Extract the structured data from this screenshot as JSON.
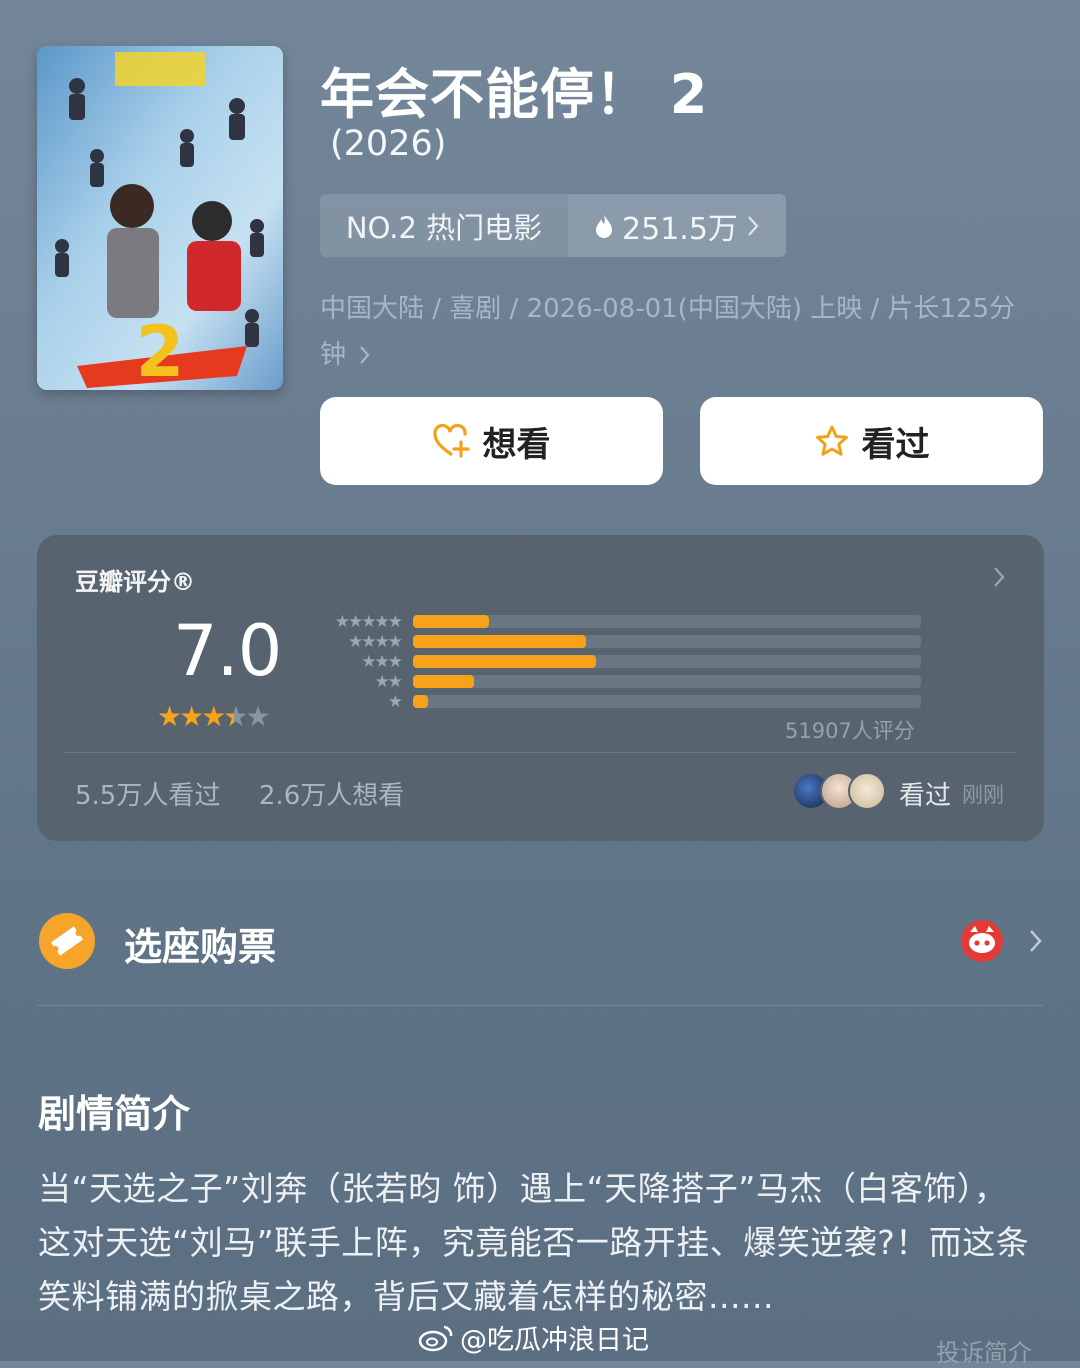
{
  "movie": {
    "title": "年会不能停！ 2",
    "year": "(2026)",
    "rank": "NO.2 热门电影",
    "heat": "251.5万",
    "meta_line": "中国大陆 / 喜剧 / 2026-08-01(中国大陆) 上映 / 片长125分钟"
  },
  "actions": {
    "want_label": "想看",
    "seen_label": "看过"
  },
  "rating": {
    "title": "豆瓣评分®",
    "score": "7.0",
    "stars_value": 3.5,
    "stars_max": 5,
    "distribution": [
      {
        "stars": "★★★★★",
        "fraction": 0.15
      },
      {
        "stars": "★★★★",
        "fraction": 0.34
      },
      {
        "stars": "★★★",
        "fraction": 0.36
      },
      {
        "stars": "★★",
        "fraction": 0.12
      },
      {
        "stars": "★",
        "fraction": 0.03
      }
    ],
    "count": "51907人评分",
    "seen_count": "5.5万人看过",
    "want_count": "2.6万人想看",
    "friend_action": "看过",
    "friend_time": "刚刚"
  },
  "ticket": {
    "label": "选座购票"
  },
  "synopsis": {
    "title": "剧情简介",
    "text": "当“天选之子”刘奔（张若昀 饰）遇上“天降搭子”马杰（白客饰），这对天选“刘马”联手上阵，究竟能否一路开挂、爆笑逆袭?！而这条笑料铺满的掀桌之路，背后又藏着怎样的秘密......",
    "report": "投诉简介"
  },
  "watermark": "@吃瓜冲浪日记",
  "colors": {
    "accent": "#f7a219",
    "card": "#57646f",
    "background": "#6a7d90"
  }
}
